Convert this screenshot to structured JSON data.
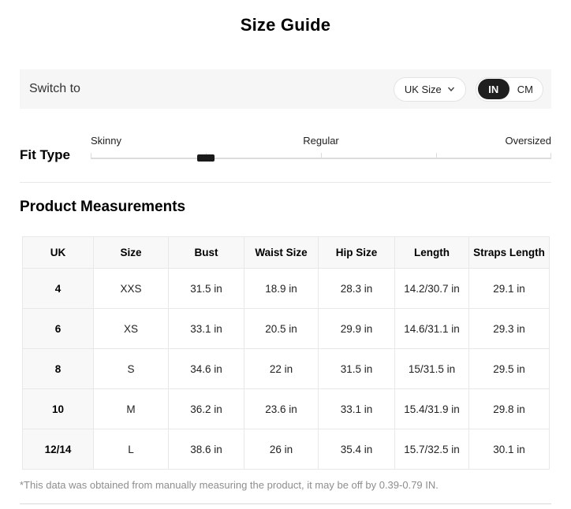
{
  "title": "Size Guide",
  "switch_bar": {
    "label": "Switch to",
    "size_dropdown": {
      "value": "UK Size",
      "chevron_icon": "chevron-down-icon"
    },
    "unit_toggle": {
      "options": [
        "IN",
        "CM"
      ],
      "selected": "IN"
    }
  },
  "fit_type": {
    "label": "Fit Type",
    "options": [
      "Skinny",
      "Regular",
      "Oversized"
    ],
    "stops": 5,
    "handle_stop_index": 1
  },
  "measurements": {
    "heading": "Product Measurements",
    "columns": [
      "UK",
      "Size",
      "Bust",
      "Waist Size",
      "Hip Size",
      "Length",
      "Straps Length"
    ],
    "rows": [
      [
        "4",
        "XXS",
        "31.5 in",
        "18.9 in",
        "28.3 in",
        "14.2/30.7 in",
        "29.1 in"
      ],
      [
        "6",
        "XS",
        "33.1 in",
        "20.5 in",
        "29.9 in",
        "14.6/31.1 in",
        "29.3 in"
      ],
      [
        "8",
        "S",
        "34.6 in",
        "22 in",
        "31.5 in",
        "15/31.5 in",
        "29.5 in"
      ],
      [
        "10",
        "M",
        "36.2 in",
        "23.6 in",
        "33.1 in",
        "15.4/31.9 in",
        "29.8 in"
      ],
      [
        "12/14",
        "L",
        "38.6 in",
        "26 in",
        "35.4 in",
        "15.7/32.5 in",
        "30.1 in"
      ]
    ]
  },
  "footnote": "*This data was obtained from manually measuring the product, it may be off by 0.39-0.79 IN.",
  "colors": {
    "accent_dark": "#1f1f1f",
    "bar_background": "#f6f6f6",
    "table_header_background": "#f8f8f8",
    "border": "#e8e8e8",
    "footnote_text": "#8e8e8e"
  }
}
